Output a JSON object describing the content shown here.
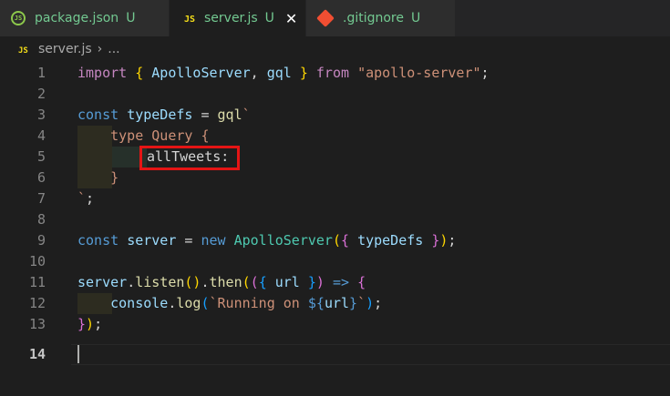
{
  "tabs": [
    {
      "label": "package.json",
      "status": "U",
      "icon": "nodejs-icon"
    },
    {
      "label": "server.js",
      "status": "U",
      "icon": "js-icon",
      "close": "✕"
    },
    {
      "label": ".gitignore",
      "status": "U",
      "icon": "git-icon"
    }
  ],
  "breadcrumb": {
    "file": "server.js",
    "sep": "›",
    "more": "..."
  },
  "editor": {
    "line_numbers": [
      "1",
      "2",
      "3",
      "4",
      "5",
      "6",
      "7",
      "8",
      "9",
      "10",
      "11",
      "12",
      "13",
      "14"
    ],
    "current_line": 14,
    "highlighted_token": "allTweets:"
  },
  "colors": {
    "tab_status": "#73c991",
    "highlight_box": "#e51515",
    "keyword": "#569cd6",
    "string": "#ce9178"
  }
}
